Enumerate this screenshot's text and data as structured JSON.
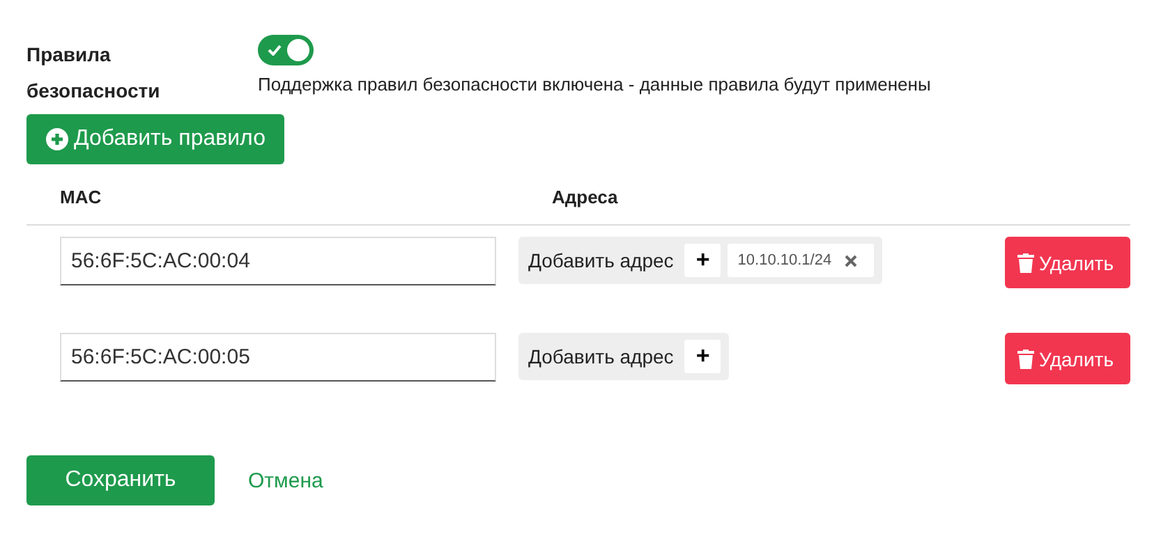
{
  "security": {
    "label": "Правила безопасности",
    "enabled": true,
    "description": "Поддержка правил безопасности включена - данные правила будут применены"
  },
  "add_rule_button": "Добавить правило",
  "table": {
    "columns": [
      "MAC",
      "Адреса"
    ],
    "rows": [
      {
        "mac": "56:6F:5C:AC:00:04",
        "add_address": "Добавить адрес",
        "add_symbol": "+",
        "addresses": [
          "10.10.10.1/24"
        ],
        "delete": "Удалить"
      },
      {
        "mac": "56:6F:5C:AC:00:05",
        "add_address": "Добавить адрес",
        "add_symbol": "+",
        "addresses": [],
        "delete": "Удалить"
      }
    ]
  },
  "save_button": "Сохранить",
  "cancel_link": "Отмена"
}
